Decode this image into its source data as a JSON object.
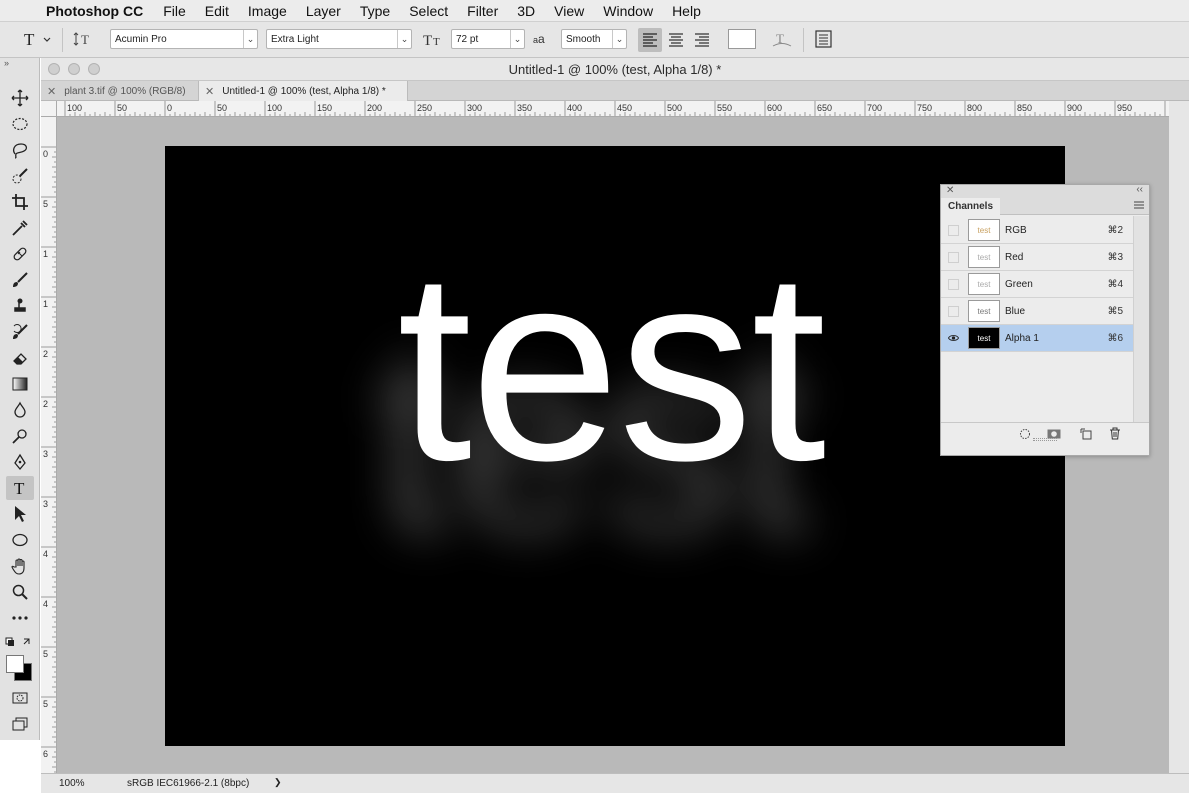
{
  "menubar": {
    "apple": "",
    "app_name": "Photoshop CC",
    "items": [
      "File",
      "Edit",
      "Image",
      "Layer",
      "Type",
      "Select",
      "Filter",
      "3D",
      "View",
      "Window",
      "Help"
    ]
  },
  "options": {
    "font_family": "Acumin Pro",
    "font_style": "Extra Light",
    "font_size": "72 pt",
    "aa_label": "a",
    "anti_alias": "Smooth"
  },
  "document": {
    "title": "Untitled-1 @ 100% (test, Alpha 1/8) *",
    "tabs": [
      {
        "label": "plant 3.tif @ 100% (RGB/8)",
        "active": false
      },
      {
        "label": "Untitled-1 @ 100% (test, Alpha 1/8) *",
        "active": true
      }
    ],
    "ruler_h_labels": [
      "100",
      "50",
      "0",
      "50",
      "100",
      "150",
      "200",
      "250",
      "300",
      "350",
      "400",
      "450",
      "500",
      "550",
      "600",
      "650",
      "700",
      "750",
      "800",
      "850",
      "900",
      "950"
    ],
    "ruler_v_labels": [
      "0",
      "5",
      "1",
      "1",
      "2",
      "2",
      "3",
      "3",
      "4",
      "4",
      "5",
      "5",
      "6"
    ],
    "canvas_text": "test",
    "status": {
      "zoom": "100%",
      "profile": "sRGB IEC61966-2.1 (8bpc)",
      "arrow": "❯"
    }
  },
  "channels_panel": {
    "title": "Channels",
    "rows": [
      {
        "name": "RGB",
        "key": "⌘2",
        "visible": false,
        "selected": false
      },
      {
        "name": "Red",
        "key": "⌘3",
        "visible": false,
        "selected": false
      },
      {
        "name": "Green",
        "key": "⌘4",
        "visible": false,
        "selected": false
      },
      {
        "name": "Blue",
        "key": "⌘5",
        "visible": false,
        "selected": false
      },
      {
        "name": "Alpha 1",
        "key": "⌘6",
        "visible": true,
        "selected": true
      }
    ],
    "thumb_text": "test",
    "footer_icons": [
      "load-selection-icon",
      "save-selection-icon",
      "new-channel-icon",
      "trash-icon"
    ]
  },
  "toolbar": {
    "tools": [
      "move-tool",
      "marquee-tool",
      "lasso-tool",
      "quick-select-tool",
      "crop-tool",
      "eyedropper-tool",
      "healing-brush-tool",
      "brush-tool",
      "clone-stamp-tool",
      "history-brush-tool",
      "eraser-tool",
      "gradient-tool",
      "blur-tool",
      "dodge-tool",
      "pen-tool",
      "type-tool",
      "path-select-tool",
      "ellipse-tool",
      "hand-tool",
      "zoom-tool",
      "more-tools"
    ],
    "active_tool": "type-tool"
  },
  "colors": {
    "foreground": "#ffffff",
    "background": "#000000",
    "selection": "#b5cfee",
    "canvas": "#000000"
  }
}
